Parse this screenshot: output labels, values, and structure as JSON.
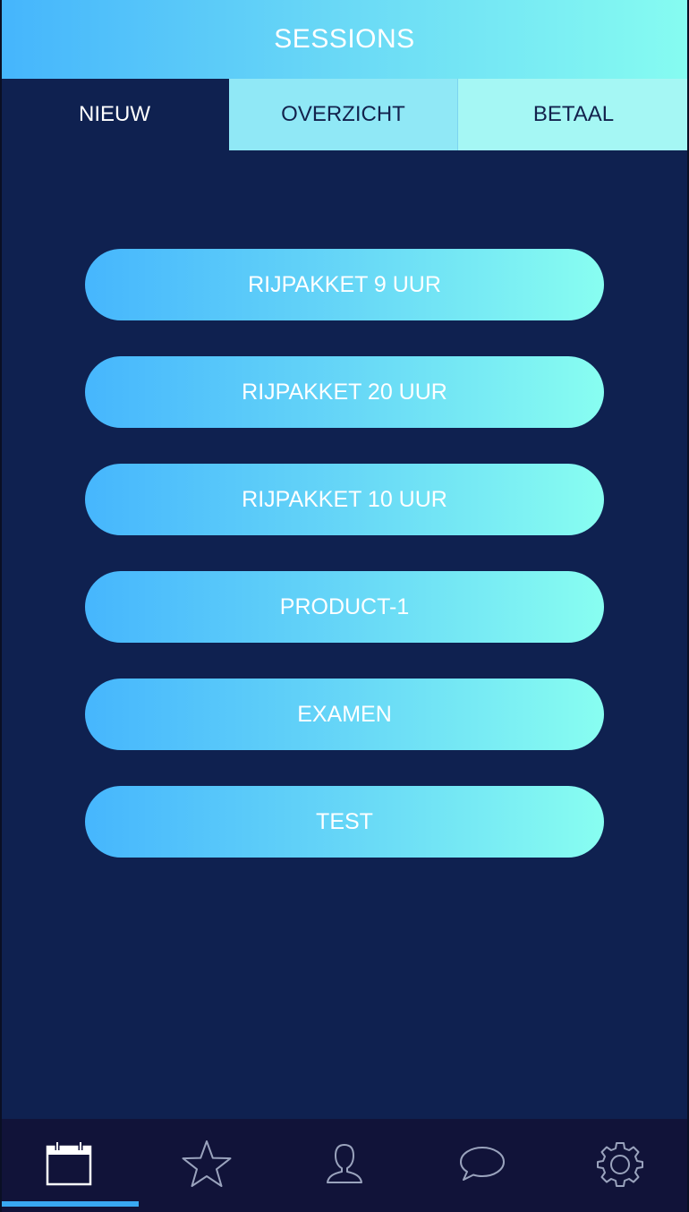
{
  "header": {
    "title": "SESSIONS"
  },
  "tabs": [
    {
      "label": "NIEUW",
      "active": true
    },
    {
      "label": "OVERZICHT",
      "active": false
    },
    {
      "label": "BETAAL",
      "active": false
    }
  ],
  "products": [
    {
      "label": "RIJPAKKET 9 UUR"
    },
    {
      "label": "RIJPAKKET 20 UUR"
    },
    {
      "label": "RIJPAKKET 10 UUR"
    },
    {
      "label": "PRODUCT-1"
    },
    {
      "label": "EXAMEN"
    },
    {
      "label": "TEST"
    }
  ],
  "bottom_nav": [
    {
      "icon": "calendar-icon",
      "active": true
    },
    {
      "icon": "star-icon",
      "active": false
    },
    {
      "icon": "user-icon",
      "active": false
    },
    {
      "icon": "chat-bubble-icon",
      "active": false
    },
    {
      "icon": "gear-icon",
      "active": false
    }
  ],
  "colors": {
    "background": "#0f2150",
    "gradient_start": "#45b5fc",
    "gradient_end": "#86fcf1",
    "nav_background": "#111339",
    "active_indicator": "#39a8f2"
  }
}
